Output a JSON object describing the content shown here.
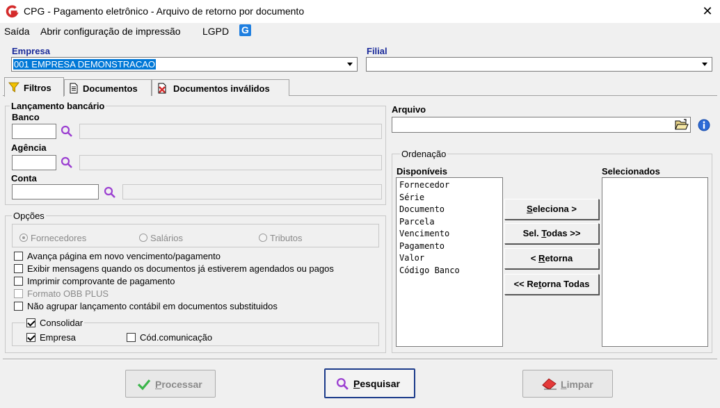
{
  "window": {
    "title": "CPG - Pagamento eletrônico - Arquivo de retorno por documento",
    "close_symbol": "✕"
  },
  "menu": {
    "items": [
      "Saída",
      "Abrir configuração de impressão",
      "LGPD"
    ],
    "lgpd_icon_letter": "G"
  },
  "empresa": {
    "label": "Empresa",
    "value": "001 EMPRESA DEMONSTRACAO"
  },
  "filial": {
    "label": "Filial",
    "value": ""
  },
  "tabs": [
    {
      "label": "Filtros",
      "icon": "funnel-icon",
      "active": true
    },
    {
      "label": "Documentos",
      "icon": "document-icon",
      "active": false
    },
    {
      "label": "Documentos inválidos",
      "icon": "invalid-document-icon",
      "active": false
    }
  ],
  "lancamento": {
    "legend": "Lançamento bancário",
    "banco_label": "Banco",
    "agencia_label": "Agência",
    "conta_label": "Conta"
  },
  "opcoes": {
    "legend": "Opções",
    "radios": [
      {
        "label": "Fornecedores",
        "checked": true
      },
      {
        "label": "Salários",
        "checked": false
      },
      {
        "label": "Tributos",
        "checked": false
      }
    ],
    "checks": [
      {
        "label": "Avança página em novo vencimento/pagamento",
        "checked": false,
        "enabled": true
      },
      {
        "label": "Exibir mensagens quando os documentos já estiverem agendados ou pagos",
        "checked": false,
        "enabled": true
      },
      {
        "label": "Imprimir comprovante de pagamento",
        "checked": false,
        "enabled": true
      },
      {
        "label": "Formato OBB PLUS",
        "checked": false,
        "enabled": false
      },
      {
        "label": "Não agrupar lançamento contábil em documentos substituidos",
        "checked": false,
        "enabled": true
      }
    ],
    "consolidar": {
      "label": "Consolidar",
      "checked": true
    },
    "empresa_check": {
      "label": "Empresa",
      "checked": true
    },
    "cod_comunicacao": {
      "label": "Cód.comunicação",
      "checked": false
    }
  },
  "arquivo": {
    "label": "Arquivo",
    "value": ""
  },
  "ordenacao": {
    "legend": "Ordenação",
    "disponiveis_label": "Disponíveis",
    "selecionados_label": "Selecionados",
    "disponiveis": [
      "Fornecedor",
      "Série",
      "Documento",
      "Parcela",
      "Vencimento",
      "Pagamento",
      "Valor",
      "Código Banco"
    ],
    "selecionados": [],
    "buttons": {
      "seleciona": {
        "pre": "",
        "key": "S",
        "post": "eleciona >"
      },
      "sel_todas": {
        "pre": "Sel. ",
        "key": "T",
        "post": "odas >>"
      },
      "retorna": {
        "pre": "< ",
        "key": "R",
        "post": "etorna"
      },
      "retorna_todas": {
        "pre": "<< Re",
        "key": "t",
        "post": "orna Todas"
      }
    }
  },
  "footer": {
    "processar": {
      "key": "P",
      "rest": "rocessar",
      "enabled": false
    },
    "pesquisar": {
      "key": "P",
      "rest": "esquisar",
      "enabled": true
    },
    "limpar": {
      "key": "L",
      "rest": "impar",
      "enabled": false
    }
  },
  "colors": {
    "label_blue": "#1a2a9a",
    "selection_blue": "#0078d7",
    "brand_red": "#d42b2b",
    "lookup_purple": "#9b3fd1",
    "check_green": "#3ab54a"
  }
}
